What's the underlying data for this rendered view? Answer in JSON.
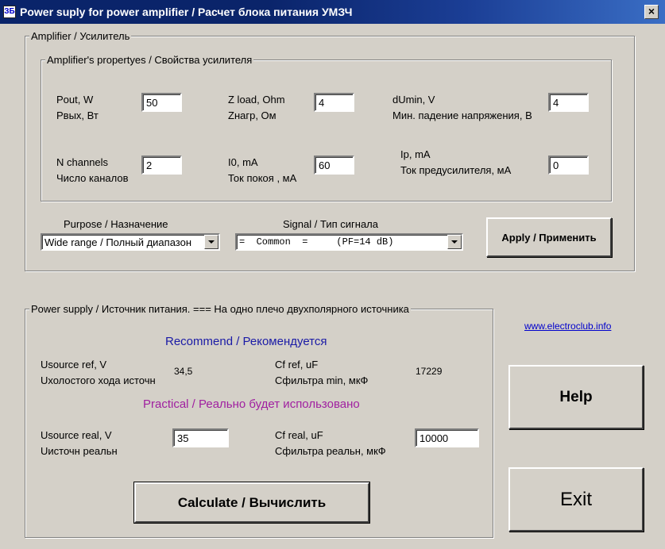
{
  "window": {
    "icon_text": "ЗБ",
    "title": "Power suply for power amplifier / Расчет блока питания УМЗЧ",
    "close_glyph": "×"
  },
  "amplifier": {
    "group_label": "Amplifier / Усилитель",
    "properties_label": "Amplifier's propertyes / Свойства усилителя",
    "pout": {
      "label_en": "Pout, W",
      "label_ru": "Рвых, Вт",
      "value": "50"
    },
    "zload": {
      "label_en": "Z load, Ohm",
      "label_ru": "Zнагр, Ом",
      "value": "4"
    },
    "dumin": {
      "label_en": "dUmin, V",
      "label_ru": "Мин. падение напряжения, В",
      "value": "4"
    },
    "nchannels": {
      "label_en": "N channels",
      "label_ru": "Число каналов",
      "value": "2"
    },
    "i0": {
      "label_en": "I0, mA",
      "label_ru": "Ток покоя , мА",
      "value": "60"
    },
    "ip": {
      "label_en": "Ip, mA",
      "label_ru": "Ток предусилителя, мА",
      "value": "0"
    },
    "purpose": {
      "label": "Purpose / Назначение",
      "selected": "Wide range / Полный диапазон"
    },
    "signal": {
      "label": "Signal / Тип сигнала",
      "selected": "=  Common  =     (PF=14 dB)"
    },
    "apply_label": "Apply / Применить"
  },
  "power_supply": {
    "group_label": "Power supply / Источник питания. ===  На одно плечо двухполярного источника",
    "recommend_title": "Recommend / Рекомендуется",
    "usource_ref": {
      "label_en": "Usource ref, V",
      "label_ru": "Uхолостого хода источн",
      "value": "34,5"
    },
    "cf_ref": {
      "label_en": "Cf ref, uF",
      "label_ru": "Сфильтра min, мкФ",
      "value": "17229"
    },
    "practical_title": "Practical / Реально будет использовано",
    "usource_real": {
      "label_en": "Usource real, V",
      "label_ru": "Uисточн реальн",
      "value": "35"
    },
    "cf_real": {
      "label_en": "Cf real, uF",
      "label_ru": "Сфильтра реальн, мкФ",
      "value": "10000"
    },
    "calculate_label": "Calculate / Вычислить"
  },
  "side": {
    "link_text": "www.electroclub.info",
    "help_label": "Help",
    "exit_label": "Exit"
  },
  "colors": {
    "title_bar": "#0a246a",
    "face": "#d4d0c8",
    "recommend": "#1a1aa6",
    "practical": "#a020a0",
    "link": "#0000cc"
  },
  "icons": {
    "app": "app-icon",
    "close": "close-icon",
    "dropdown": "chevron-down-icon"
  }
}
